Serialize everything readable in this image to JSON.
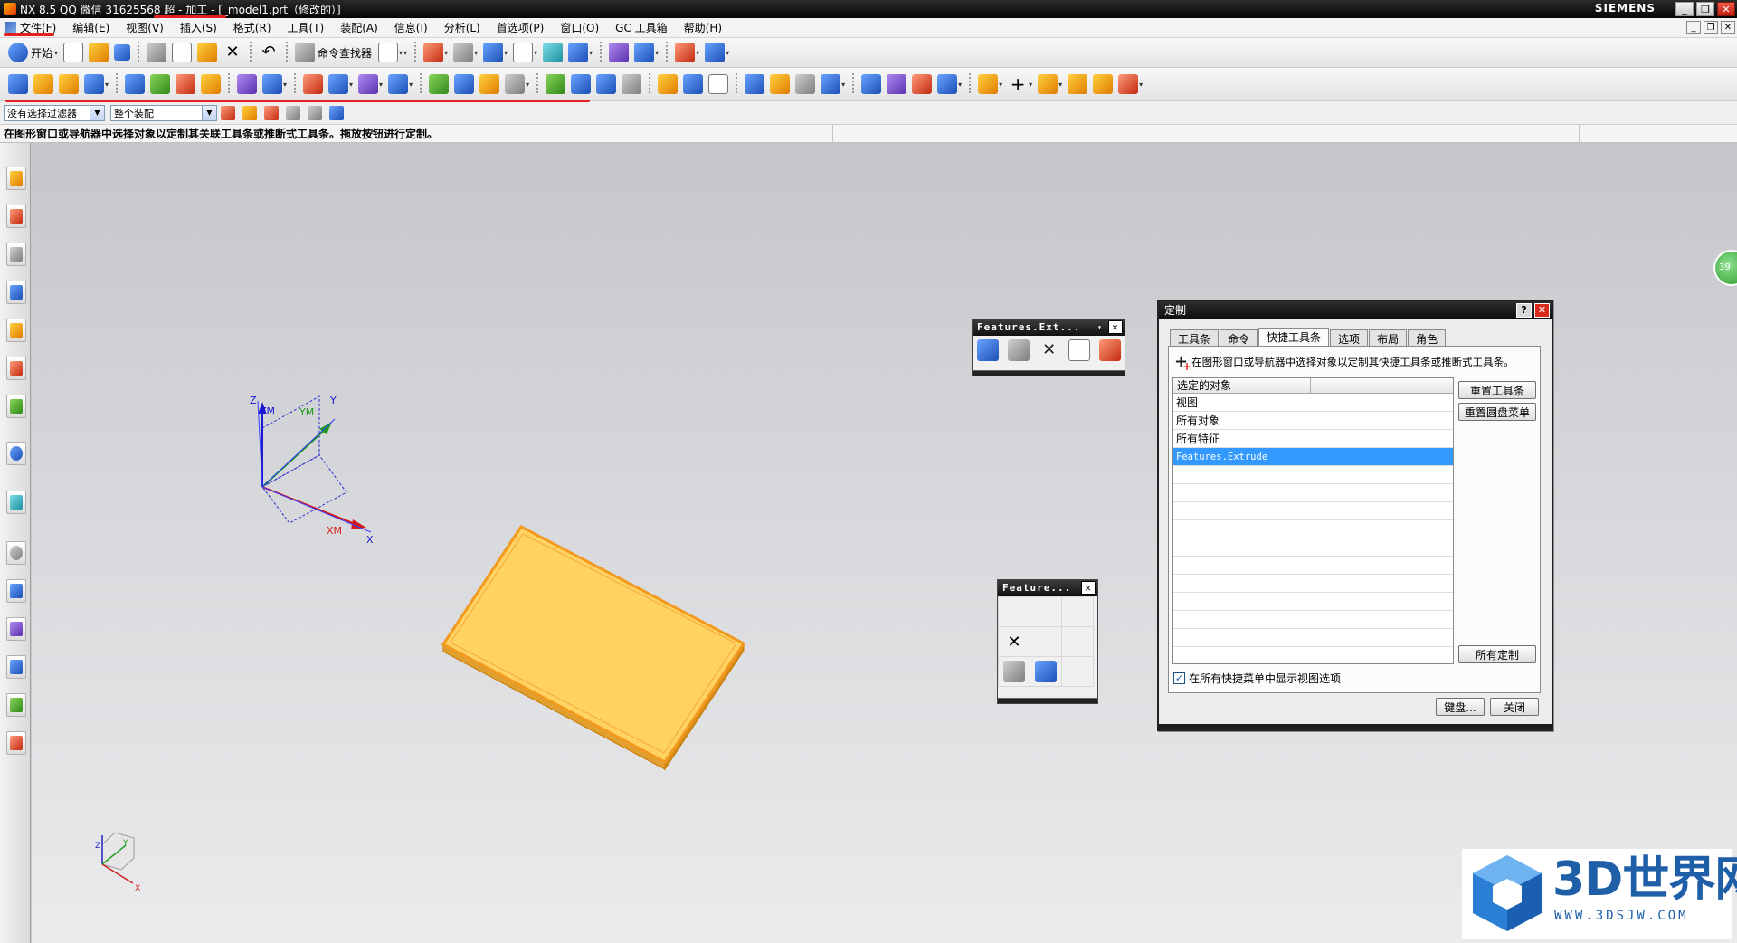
{
  "titlebar": {
    "title": "NX 8.5  QQ 微信 31625568 超 - 加工 - [_model1.prt（修改的）]",
    "brand": "SIEMENS",
    "buttons": {
      "minimize": "_",
      "restore": "❐",
      "close": "✕"
    }
  },
  "menubar": {
    "items": [
      "文件(F)",
      "编辑(E)",
      "视图(V)",
      "插入(S)",
      "格式(R)",
      "工具(T)",
      "装配(A)",
      "信息(I)",
      "分析(L)",
      "首选项(P)",
      "窗口(O)",
      "GC 工具箱",
      "帮助(H)"
    ]
  },
  "toolbar": {
    "start_label": "开始",
    "command_finder_label": "命令查找器"
  },
  "selection_bar": {
    "filter_value": "没有选择过滤器",
    "scope_value": "整个装配"
  },
  "cue_line": "在图形窗口或导航器中选择对象以定制其关联工具条或推断式工具条。拖放按钮进行定制。",
  "viewport": {
    "triad_labels": {
      "z": "Z",
      "zm": "ZM",
      "ym": "YM",
      "y": "Y",
      "xm": "XM",
      "x": "X"
    },
    "mini_triad_labels": {
      "z": "Z",
      "y": "Y",
      "x": "X"
    },
    "badge_text": "39"
  },
  "floating_toolbars": [
    {
      "title": "Features.Ext...",
      "dropdown": "▾",
      "close": "✕"
    },
    {
      "title": "Feature...",
      "close": "✕"
    }
  ],
  "dialog": {
    "title": "定制",
    "help": "?",
    "close": "✕",
    "tabs": [
      "工具条",
      "命令",
      "快捷工具条",
      "选项",
      "布局",
      "角色"
    ],
    "active_tab": "快捷工具条",
    "hint": "在图形窗口或导航器中选择对象以定制其快捷工具条或推断式工具条。",
    "list_header": "选定的对象",
    "list_items": [
      "视图",
      "所有对象",
      "所有特征",
      "Features.Extrude"
    ],
    "selected_item": "Features.Extrude",
    "buttons": {
      "reset_toolbar": "重置工具条",
      "reset_radial": "重置圆盘菜单",
      "all_custom": "所有定制",
      "keyboard": "键盘...",
      "close": "关闭"
    },
    "checkbox_label": "在所有快捷菜单中显示视图选项",
    "checkbox_checked": true
  },
  "watermark": {
    "text": "3D世界网",
    "url": "WWW.3DSJW.COM"
  },
  "colors": {
    "accent_selected": "#3399ff",
    "plate_fill": "#ffd262",
    "plate_edge": "#f29a20",
    "annotation_red": "#e32020",
    "watermark_blue": "#1e5fa8"
  }
}
